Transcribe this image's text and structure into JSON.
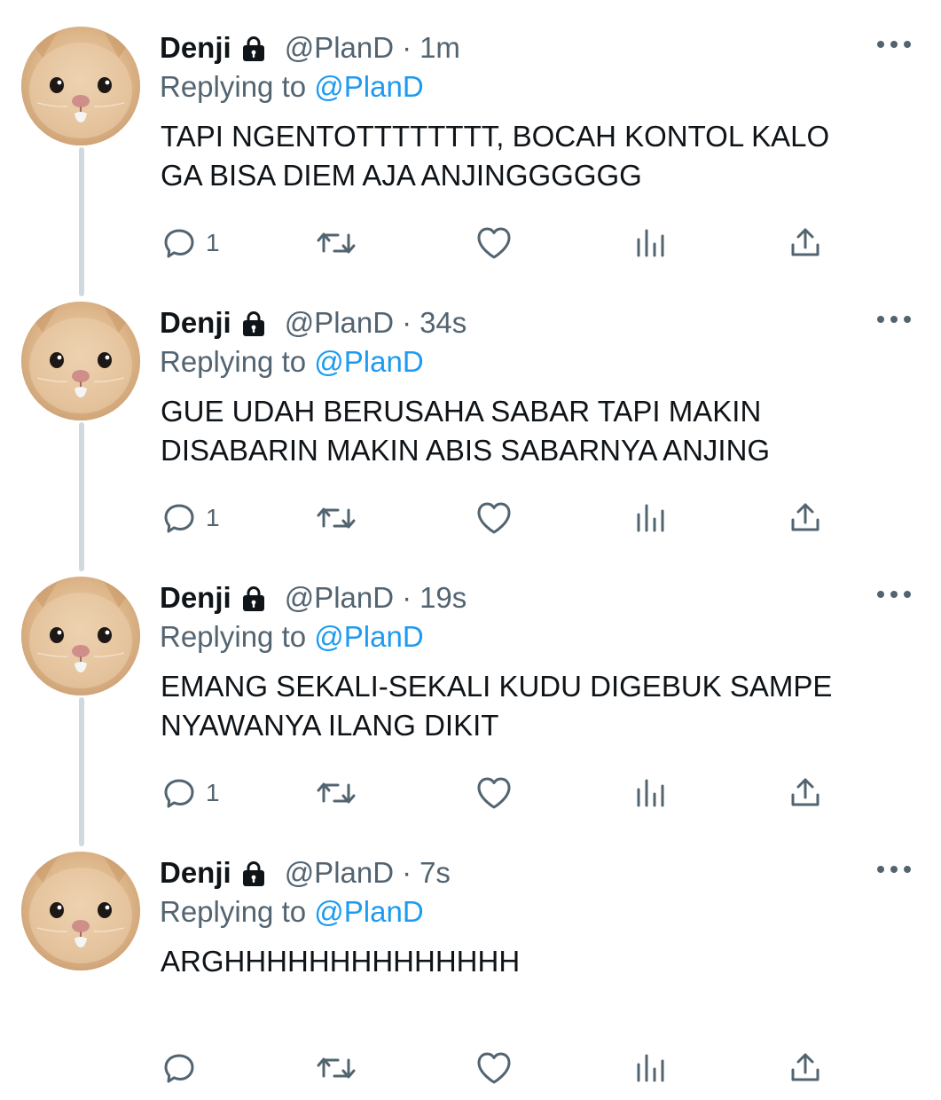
{
  "thread": {
    "tweets": [
      {
        "name": "Denji",
        "handle": "@PlanD",
        "separator": "·",
        "time": "1m",
        "replying_prefix": "Replying to ",
        "replying_to": "@PlanD",
        "text_lines": [
          "TAPI NGENTOTTTTTTTT, BOCAH KONTOL KALO",
          "GA BISA DIEM AJA ANJINGGGGGG"
        ],
        "reply_count": "1"
      },
      {
        "name": "Denji",
        "handle": "@PlanD",
        "separator": "·",
        "time": "34s",
        "replying_prefix": "Replying to ",
        "replying_to": "@PlanD",
        "text_lines": [
          "GUE UDAH BERUSAHA SABAR TAPI MAKIN",
          "DISABARIN MAKIN ABIS SABARNYA ANJING"
        ],
        "reply_count": "1"
      },
      {
        "name": "Denji",
        "handle": "@PlanD",
        "separator": "·",
        "time": "19s",
        "replying_prefix": "Replying to ",
        "replying_to": "@PlanD",
        "text_lines": [
          "EMANG SEKALI-SEKALI KUDU DIGEBUK SAMPE",
          "NYAWANYA ILANG DIKIT"
        ],
        "reply_count": "1"
      },
      {
        "name": "Denji",
        "handle": "@PlanD",
        "separator": "·",
        "time": "7s",
        "replying_prefix": "Replying to ",
        "replying_to": "@PlanD",
        "text_lines": [
          "ARGHHHHHHHHHHHHHH"
        ],
        "reply_count": ""
      }
    ]
  },
  "icons": {
    "avatar": "cat-avatar",
    "lock": "lock-icon",
    "more": "more-icon",
    "reply": "reply-icon",
    "retweet": "retweet-icon",
    "like": "heart-icon",
    "analytics": "analytics-icon",
    "share": "share-icon"
  },
  "colors": {
    "text_primary": "#0f1419",
    "text_secondary": "#536471",
    "link": "#1d9bf0",
    "thread_line": "#cfd9de",
    "background": "#ffffff"
  }
}
